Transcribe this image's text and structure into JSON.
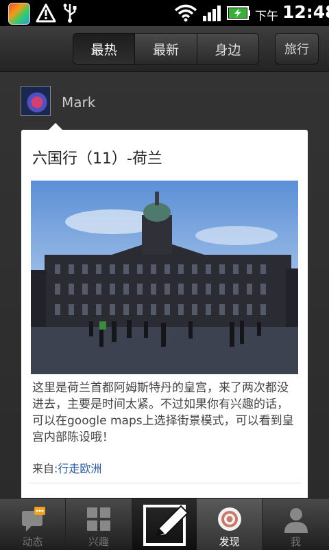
{
  "status_bar": {
    "ampm": "下午",
    "time": "12:48",
    "icons": [
      "app-icon",
      "warning-icon",
      "usb-icon",
      "wifi-icon",
      "signal-icon",
      "battery-charging-icon"
    ]
  },
  "top_tabs": {
    "tabs": [
      {
        "label": "最热",
        "active": true
      },
      {
        "label": "最新",
        "active": false
      },
      {
        "label": "身边",
        "active": false
      }
    ],
    "travel_label": "旅行"
  },
  "post": {
    "user": "Mark",
    "title": "六国行（11）-荷兰",
    "body": "这里是荷兰首都阿姆斯特丹的皇宫，来了两次都没进去，主要是时间太紧。不过如果你有兴趣的话，可以在google maps上选择街景模式，可以看到皇宫内部陈设哦！",
    "source_prefix": "来自:",
    "source_link": "行走欧洲"
  },
  "bottom_nav": {
    "items": [
      {
        "label": "动态",
        "icon": "chat-bubble-icon",
        "badge": "..."
      },
      {
        "label": "兴趣",
        "icon": "grid-icon"
      },
      {
        "label": "",
        "icon": "compose-pencil-icon"
      },
      {
        "label": "发现",
        "icon": "target-icon",
        "active": true
      },
      {
        "label": "我",
        "icon": "person-icon"
      }
    ]
  },
  "colors": {
    "link": "#2a5a9a",
    "card_bg": "#ffffff",
    "chrome": "#2b2b2b"
  }
}
